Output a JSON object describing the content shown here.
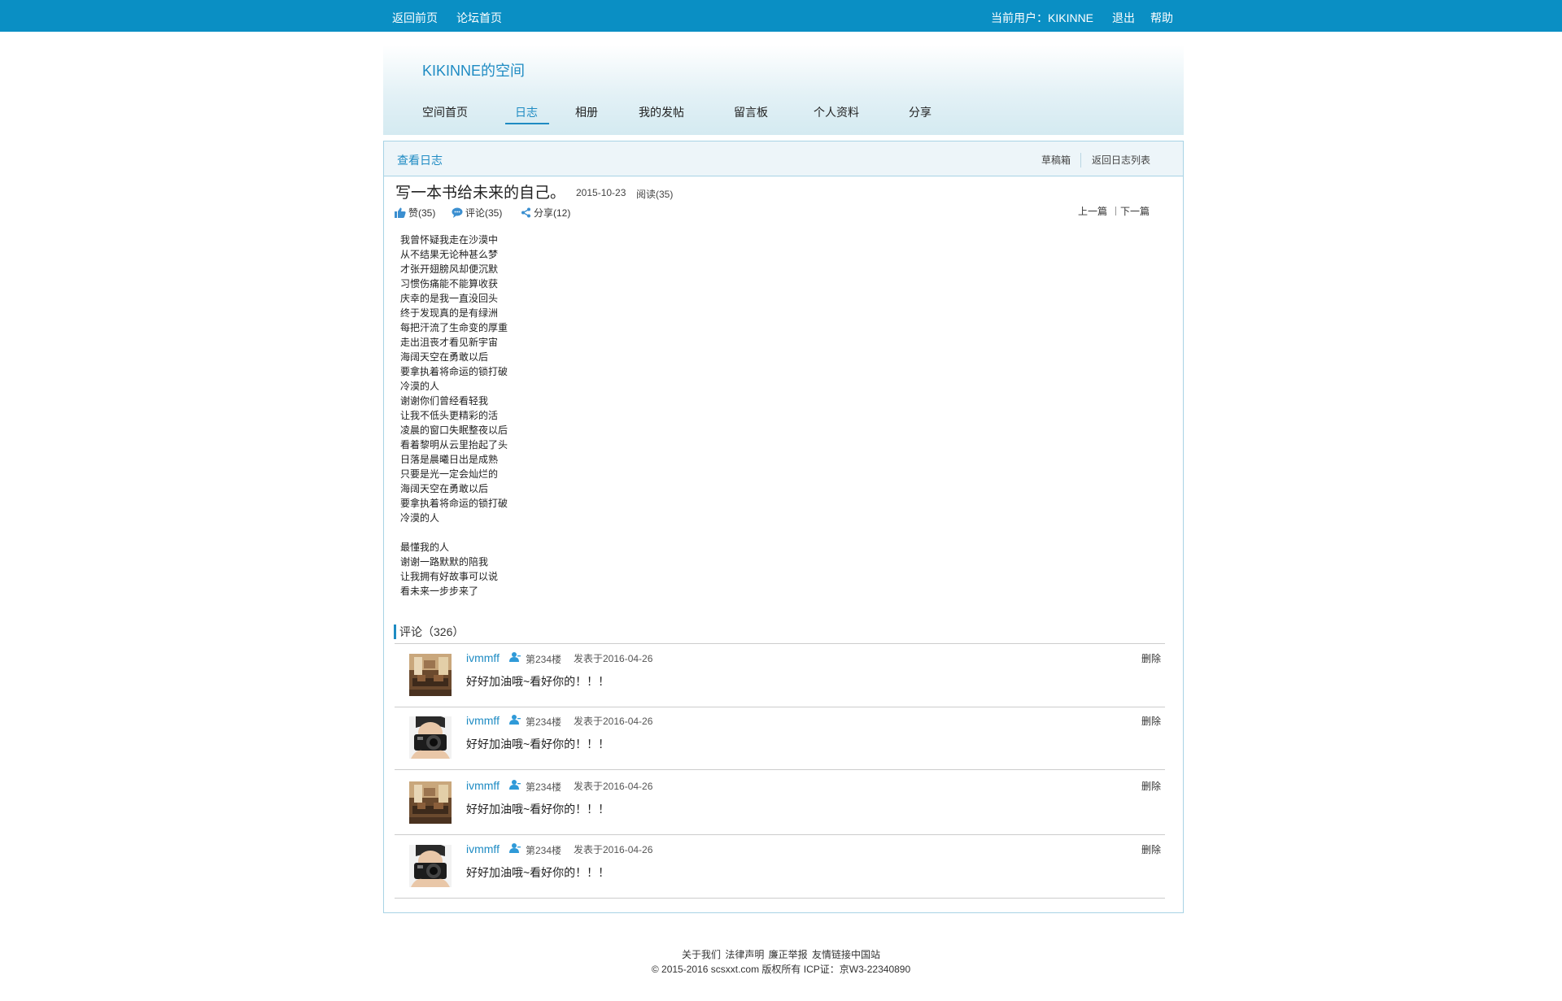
{
  "topbar": {
    "home": "返回前页",
    "forum": "论坛首页",
    "current_user": "当前用户：KIKINNE",
    "logout": "退出",
    "help": "帮助"
  },
  "header": {
    "space_title": "KIKINNE的空间",
    "nav": [
      "空间首页",
      "日志",
      "相册",
      "我的发帖",
      "留言板",
      "个人资料",
      "分享"
    ],
    "active_nav": "日志"
  },
  "panel": {
    "title": "查看日志",
    "drafts": "草稿箱",
    "back_to_list": "返回日志列表"
  },
  "post": {
    "title": "写一本书给未来的自己。",
    "date": "2015-10-23",
    "reads": "阅读(35)",
    "likes": "赞(35)",
    "comments": "评论(35)",
    "shares": "分享(12)",
    "prev": "上一篇",
    "next": "下一篇",
    "lines": [
      "我曾怀疑我走在沙漠中",
      "从不结果无论种甚么梦",
      "才张开翅膀风却便沉默",
      "习惯伤痛能不能算收获",
      "庆幸的是我一直没回头",
      "终于发现真的是有绿洲",
      "每把汗流了生命变的厚重",
      "走出沮丧才看见新宇宙",
      "海阔天空在勇敢以后",
      "要拿执着将命运的锁打破",
      "冷漠的人",
      "谢谢你们曾经看轻我",
      "让我不低头更精彩的活",
      "凌晨的窗口失眠整夜以后",
      "看着黎明从云里抬起了头",
      "日落是晨曦日出是成熟",
      "只要是光一定会灿烂的",
      "海阔天空在勇敢以后",
      "要拿执着将命运的锁打破",
      "冷漠的人",
      "",
      "最懂我的人",
      "谢谢一路默默的陪我",
      "让我拥有好故事可以说",
      "看未来一步步来了"
    ]
  },
  "comments_section": {
    "heading": "评论（326）",
    "items": [
      {
        "user": "ivmmff",
        "floor": "第234楼",
        "date": "发表于2016-04-26",
        "delete": "删除",
        "text": "好好加油哦~看好你的！！！",
        "avatar": "interior-photo"
      },
      {
        "user": "ivmmff",
        "floor": "第234楼",
        "date": "发表于2016-04-26",
        "delete": "删除",
        "text": "好好加油哦~看好你的！！！",
        "avatar": "camera-person-photo"
      },
      {
        "user": "ivmmff",
        "floor": "第234楼",
        "date": "发表于2016-04-26",
        "delete": "删除",
        "text": "好好加油哦~看好你的！！！",
        "avatar": "interior-photo"
      },
      {
        "user": "ivmmff",
        "floor": "第234楼",
        "date": "发表于2016-04-26",
        "delete": "删除",
        "text": "好好加油哦~看好你的！！！",
        "avatar": "camera-person-photo"
      }
    ]
  },
  "footer": {
    "links": [
      "关于我们",
      "法律声明",
      "廉正举报",
      "友情链接中国站"
    ],
    "copyright": "© 2015-2016 scsxxt.com 版权所有 ICP证：京W3-22340890"
  },
  "colors": {
    "topbar": "#0a8fc4",
    "accent": "#1e8bc3",
    "panel_border": "#a8d3e5"
  }
}
